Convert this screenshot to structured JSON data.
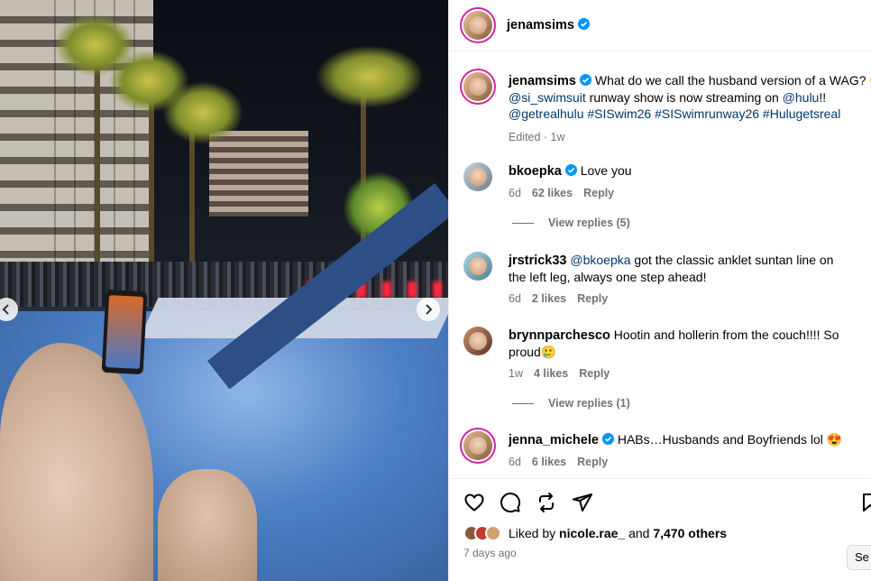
{
  "post": {
    "author": "jenamsims",
    "caption_lines": [
      {
        "parts": [
          {
            "t": "text",
            "v": "What do we call the husband version of a WAG? "
          },
          {
            "t": "emoji",
            "v": "😉"
          }
        ]
      },
      {
        "parts": [
          {
            "t": "tag",
            "v": "@si_swimsuit"
          },
          {
            "t": "text",
            "v": " runway show is now streaming on "
          },
          {
            "t": "tag",
            "v": "@hulu"
          },
          {
            "t": "text",
            "v": "!!"
          }
        ]
      },
      {
        "parts": [
          {
            "t": "tag",
            "v": "@getrealhulu"
          },
          {
            "t": "text",
            "v": " "
          },
          {
            "t": "tag",
            "v": "#SISwim26"
          },
          {
            "t": "text",
            "v": " "
          },
          {
            "t": "tag",
            "v": "#SISwimrunway26"
          },
          {
            "t": "text",
            "v": " "
          },
          {
            "t": "tag",
            "v": "#Hulugetsreal"
          }
        ]
      }
    ],
    "edited": "Edited · 1w"
  },
  "comments": [
    {
      "user": "bkoepka",
      "verified": true,
      "mention": "",
      "text": "Love you",
      "age": "6d",
      "likes": "62 likes",
      "reply": "Reply",
      "view_replies": "View replies (5)"
    },
    {
      "user": "jrstrick33",
      "verified": false,
      "mention": "@bkoepka",
      "text": " got the classic anklet suntan line on the left leg, always one step ahead!",
      "age": "6d",
      "likes": "2 likes",
      "reply": "Reply",
      "view_replies": ""
    },
    {
      "user": "brynnparchesco",
      "verified": false,
      "mention": "",
      "text": "Hootin and hollerin from the couch!!!! So proud🥲",
      "age": "1w",
      "likes": "4 likes",
      "reply": "Reply",
      "view_replies": "View replies (1)"
    },
    {
      "user": "jenna_michele",
      "verified": true,
      "mention": "",
      "text": "HABs…Husbands and Boyfriends lol 😍",
      "age": "6d",
      "likes": "6 likes",
      "reply": "Reply",
      "view_replies": ""
    }
  ],
  "likes": {
    "prefix": "Liked by ",
    "first_user": "nicole.rae_",
    "middle": " and ",
    "others": "7,470 others"
  },
  "time_ago": "7 days ago",
  "see_label": "Se",
  "colors": {
    "link": "#00376b",
    "verified": "#0095f6",
    "muted": "#737373"
  },
  "icons": {
    "prev": "chevron-left-icon",
    "next": "chevron-right-icon",
    "like": "heart-icon",
    "comment": "comment-icon",
    "share": "repost-icon",
    "send": "send-icon",
    "save": "bookmark-icon"
  }
}
